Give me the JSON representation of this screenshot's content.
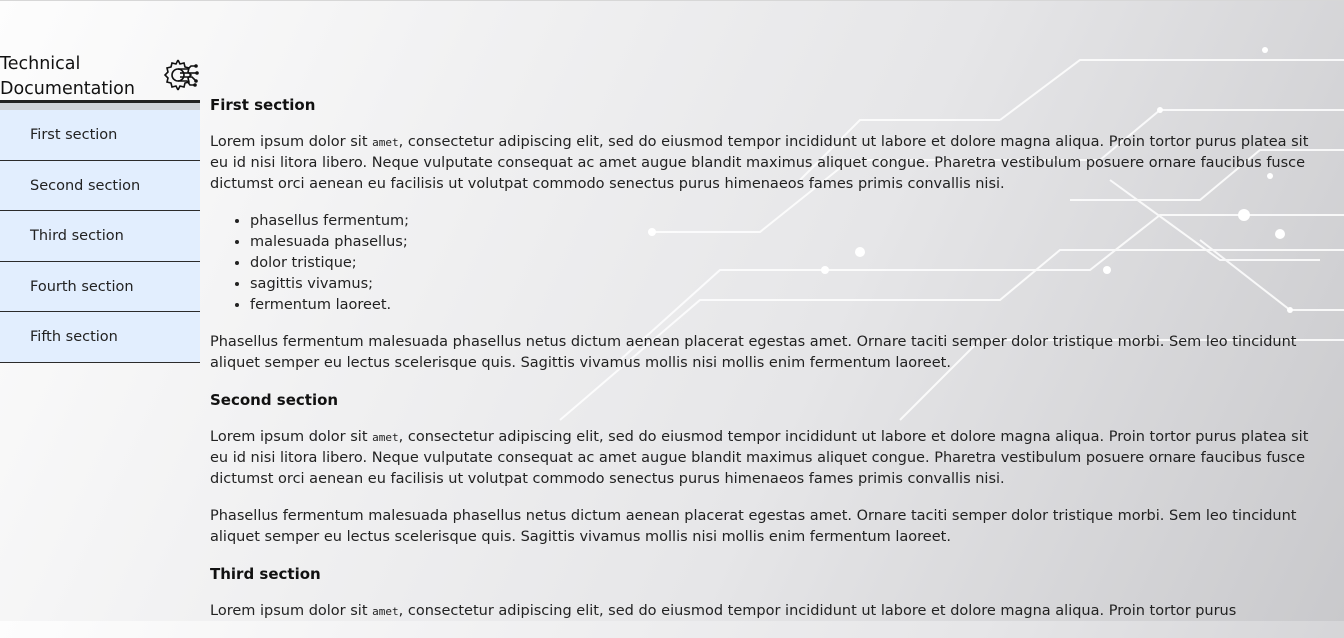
{
  "navbar": {
    "title": "Technical Documentation",
    "logo_icon": "circuit-gear-icon",
    "items": [
      {
        "label": "First section"
      },
      {
        "label": "Second section"
      },
      {
        "label": "Third section"
      },
      {
        "label": "Fourth section"
      },
      {
        "label": "Fifth section"
      }
    ]
  },
  "sections": [
    {
      "header": "First section",
      "p1_before": "Lorem ipsum dolor sit ",
      "p1_code": "amet",
      "p1_after": ", consectetur adipiscing elit, sed do eiusmod tempor incididunt ut labore et dolore magna aliqua. Proin tortor purus platea sit eu id nisi litora libero. Neque vulputate consequat ac amet augue blandit maximus aliquet congue. Pharetra vestibulum posuere ornare faucibus fusce dictumst orci aenean eu facilisis ut volutpat commodo senectus purus himenaeos fames primis convallis nisi.",
      "list": [
        "phasellus fermentum;",
        "malesuada phasellus;",
        "dolor tristique;",
        "sagittis vivamus;",
        "fermentum laoreet."
      ],
      "p2": "Phasellus fermentum malesuada phasellus netus dictum aenean placerat egestas amet. Ornare taciti semper dolor tristique morbi. Sem leo tincidunt aliquet semper eu lectus scelerisque quis. Sagittis vivamus mollis nisi mollis enim fermentum laoreet."
    },
    {
      "header": "Second section",
      "p1_before": "Lorem ipsum dolor sit ",
      "p1_code": "amet",
      "p1_after": ", consectetur adipiscing elit, sed do eiusmod tempor incididunt ut labore et dolore magna aliqua. Proin tortor purus platea sit eu id nisi litora libero. Neque vulputate consequat ac amet augue blandit maximus aliquet congue. Pharetra vestibulum posuere ornare faucibus fusce dictumst orci aenean eu facilisis ut volutpat commodo senectus purus himenaeos fames primis convallis nisi.",
      "p2": "Phasellus fermentum malesuada phasellus netus dictum aenean placerat egestas amet. Ornare taciti semper dolor tristique morbi. Sem leo tincidunt aliquet semper eu lectus scelerisque quis. Sagittis vivamus mollis nisi mollis enim fermentum laoreet."
    },
    {
      "header": "Third section",
      "p1_before": "Lorem ipsum dolor sit ",
      "p1_code": "amet",
      "p1_after": ", consectetur adipiscing elit, sed do eiusmod tempor incididunt ut labore et dolore magna aliqua. Proin tortor purus"
    }
  ],
  "colors": {
    "nav_item_bg": "#e2eefe",
    "nav_border": "#2b2b2b"
  }
}
